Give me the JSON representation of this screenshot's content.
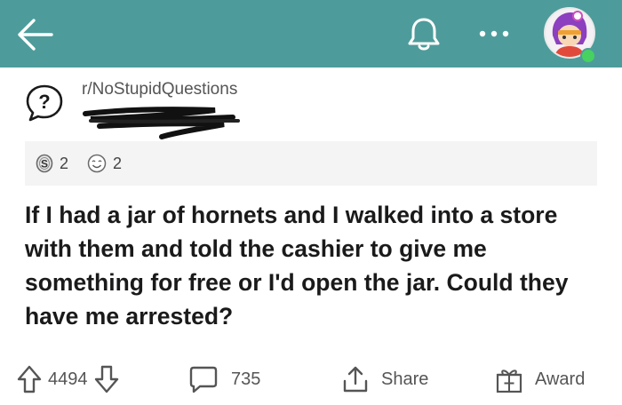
{
  "colors": {
    "header_bg": "#4d9c9b",
    "online": "#46d160"
  },
  "header": {
    "icons": [
      "back-arrow-icon",
      "bell-icon",
      "more-dots-icon",
      "user-avatar"
    ]
  },
  "post": {
    "subreddit": "r/NoStupidQuestions",
    "awards": [
      {
        "icon": "silver-coin-icon",
        "count": "2"
      },
      {
        "icon": "wholesome-face-icon",
        "count": "2"
      }
    ],
    "title": "If I had a jar of hornets and I walked into a store with them and told the cashier to give me something for free or I'd open the jar. Could they have me arrested?"
  },
  "actions": {
    "votes": "4494",
    "comments": "735",
    "share_label": "Share",
    "award_label": "Award"
  }
}
